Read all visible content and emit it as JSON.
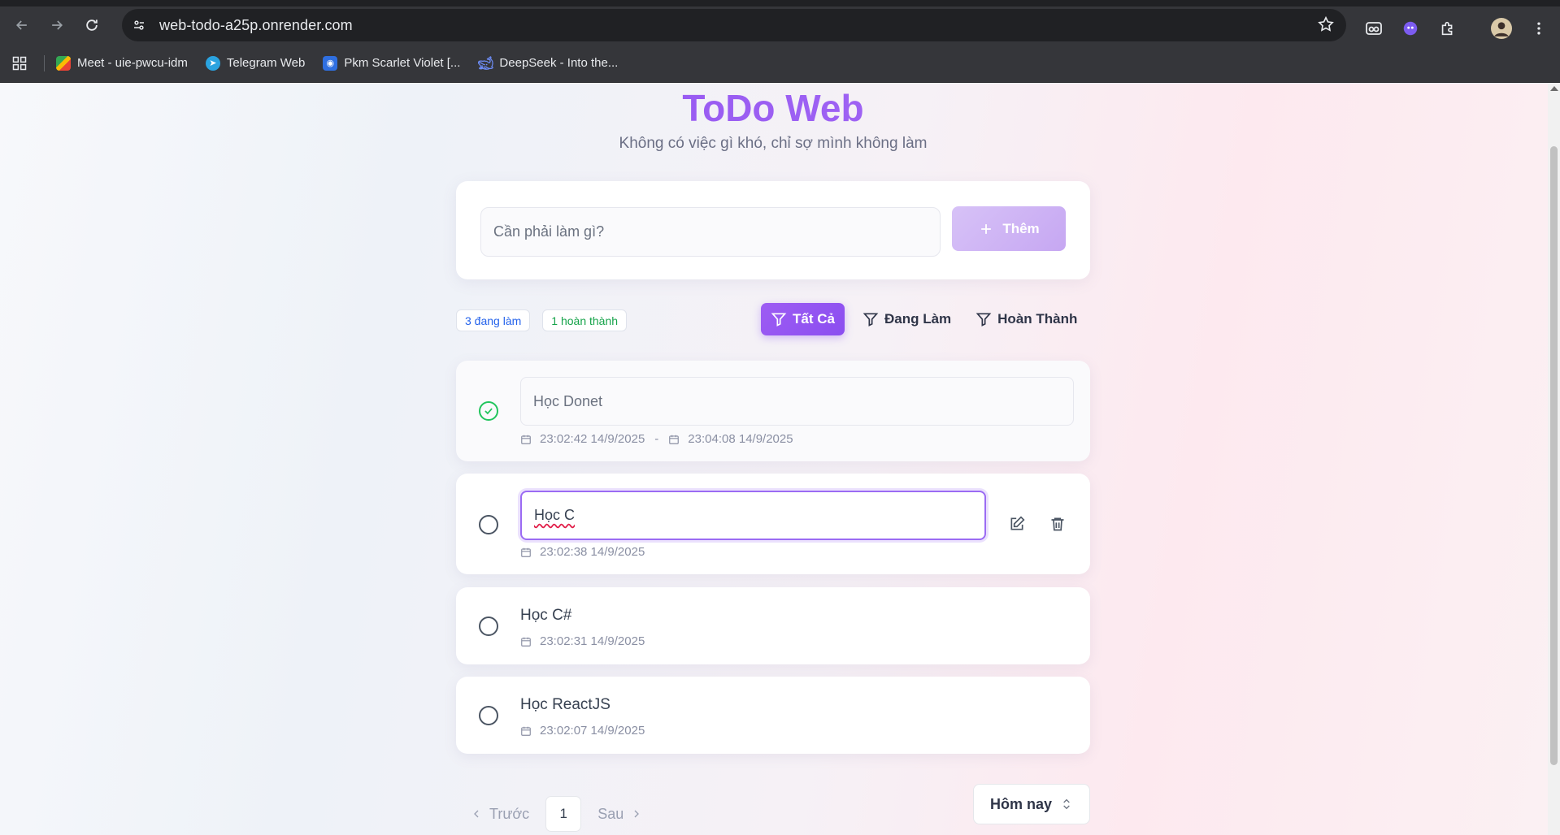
{
  "browser": {
    "url": "web-todo-a25p.onrender.com",
    "bookmarks": [
      {
        "label": "Meet - uie-pwcu-idm",
        "icon": "google-meet-icon"
      },
      {
        "label": "Telegram Web",
        "icon": "telegram-icon"
      },
      {
        "label": "Pkm Scarlet Violet [...",
        "icon": "pkm-icon"
      },
      {
        "label": "DeepSeek - Into the...",
        "icon": "deepseek-icon"
      }
    ]
  },
  "app": {
    "title": "ToDo Web",
    "subtitle": "Không có việc gì khó, chỉ sợ mình không làm",
    "add": {
      "placeholder": "Cần phải làm gì?",
      "button_label": "Thêm"
    },
    "stats": {
      "active": "3 đang làm",
      "completed": "1 hoàn thành"
    },
    "filters": {
      "all": "Tất Cả",
      "active": "Đang Làm",
      "completed": "Hoàn Thành"
    },
    "tasks": [
      {
        "title": "Học Donet",
        "completed": true,
        "created": "23:02:42 14/9/2025",
        "separator": "-",
        "completed_at": "23:04:08 14/9/2025"
      },
      {
        "title": "Học C",
        "completed": false,
        "editing": true,
        "created": "23:02:38 14/9/2025"
      },
      {
        "title": "Học C#",
        "completed": false,
        "created": "23:02:31 14/9/2025"
      },
      {
        "title": "Học ReactJS",
        "completed": false,
        "created": "23:02:07 14/9/2025"
      }
    ],
    "pagination": {
      "prev": "Trước",
      "page": "1",
      "next": "Sau"
    },
    "period": "Hôm nay"
  },
  "colors": {
    "accent": "#8b5cf6",
    "done": "#22c55e",
    "stat_blue": "#2563eb",
    "stat_green": "#16a34a"
  }
}
